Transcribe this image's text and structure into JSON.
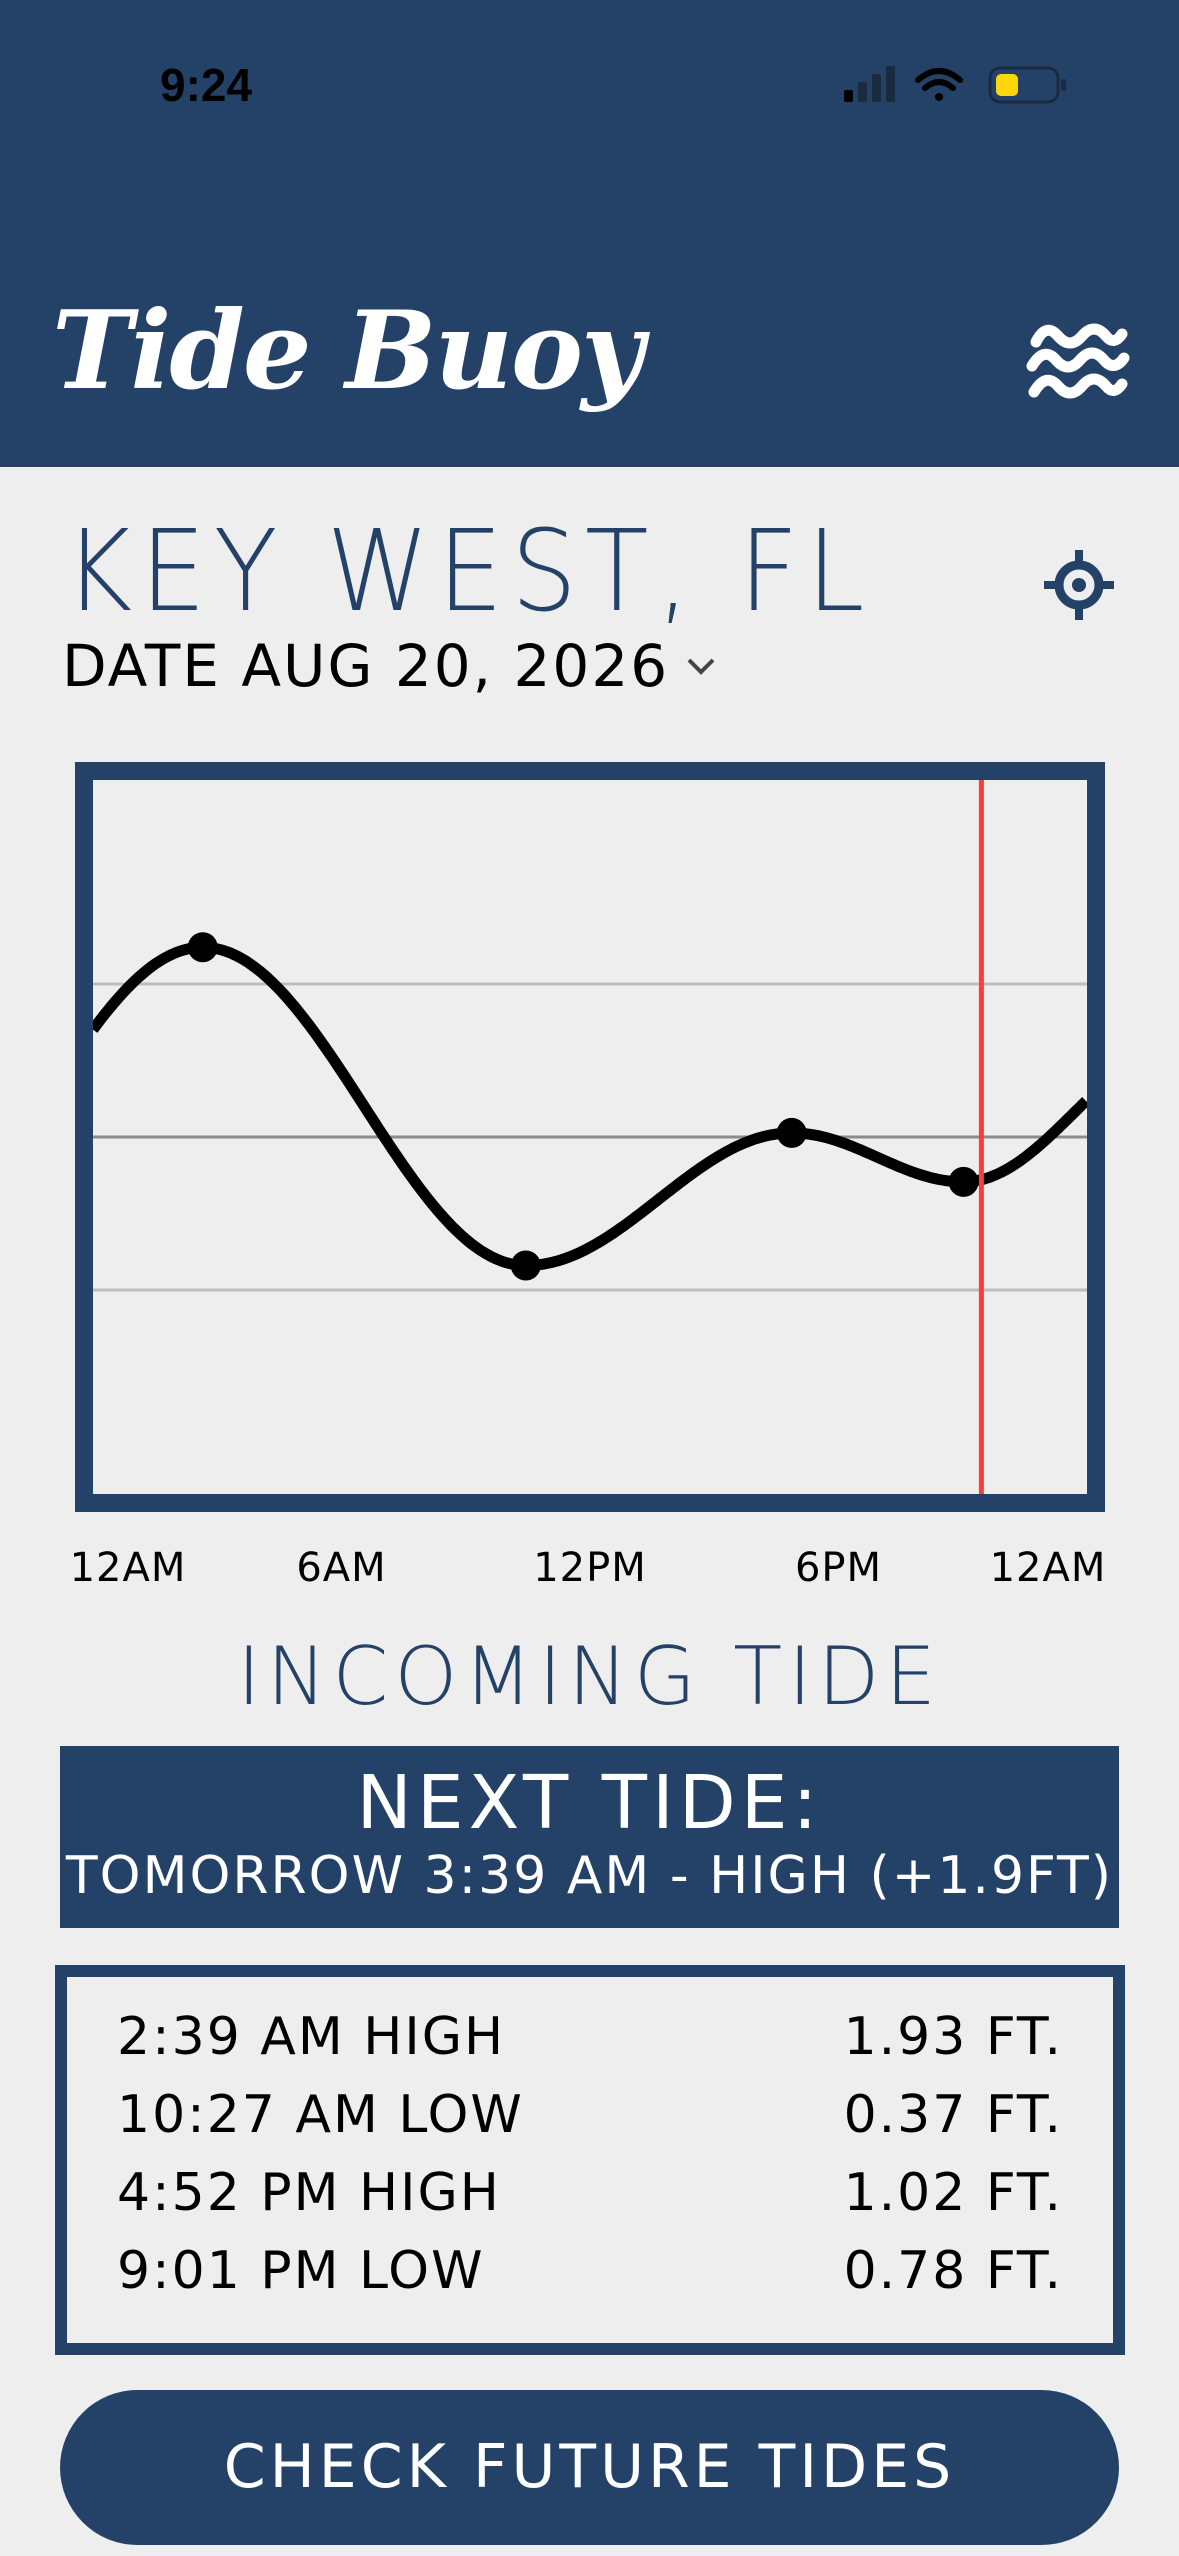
{
  "status_bar": {
    "time": "9:24"
  },
  "app": {
    "logo_text": "Tide Buoy"
  },
  "location": {
    "name": "KEY WEST, FL"
  },
  "date": {
    "label": "DATE AUG 20, 2026"
  },
  "chart_data": {
    "type": "line",
    "x_ticks": [
      "12AM",
      "6AM",
      "12PM",
      "6PM",
      "12AM"
    ],
    "xlim_hours": [
      0,
      24
    ],
    "ylim_ft": [
      -0.75,
      2.75
    ],
    "gridlines_ft": [
      0.25,
      1.0,
      1.75
    ],
    "grid": true,
    "series": [
      {
        "points": [
          {
            "time": "2:39 AM",
            "hour": 2.65,
            "height_ft": 1.93
          },
          {
            "time": "10:27 AM",
            "hour": 10.45,
            "height_ft": 0.37
          },
          {
            "time": "4:52 PM",
            "hour": 16.87,
            "height_ft": 1.02
          },
          {
            "time": "9:01 PM",
            "hour": 21.02,
            "height_ft": 0.78
          }
        ]
      }
    ],
    "current_time_hour": 21.45,
    "colors": {
      "line": "#000000",
      "now_marker": "#ff3b3b",
      "frame": "#244268",
      "grid": "#bdbdbd",
      "mid_grid": "#8c8c8c"
    }
  },
  "tide_state": "INCOMING TIDE",
  "next_tide": {
    "title": "NEXT TIDE:",
    "detail": "TOMORROW 3:39 AM - HIGH (+1.9FT)"
  },
  "tides": [
    {
      "label": "2:39 AM HIGH",
      "value": "1.93 FT."
    },
    {
      "label": "10:27 AM LOW",
      "value": "0.37 FT."
    },
    {
      "label": "4:52 PM HIGH",
      "value": "1.02 FT."
    },
    {
      "label": "9:01 PM LOW",
      "value": "0.78 FT."
    }
  ],
  "future_button": {
    "label": "CHECK FUTURE TIDES"
  },
  "icons": {
    "menu": "waves-icon",
    "locate": "crosshair-icon",
    "date_dropdown": "chevron-down-icon",
    "signal": "cellular-signal-icon",
    "wifi": "wifi-icon",
    "battery": "battery-icon"
  },
  "colors": {
    "brand": "#244268",
    "background": "#eeeeee",
    "battery_low": "#ffd60a"
  }
}
